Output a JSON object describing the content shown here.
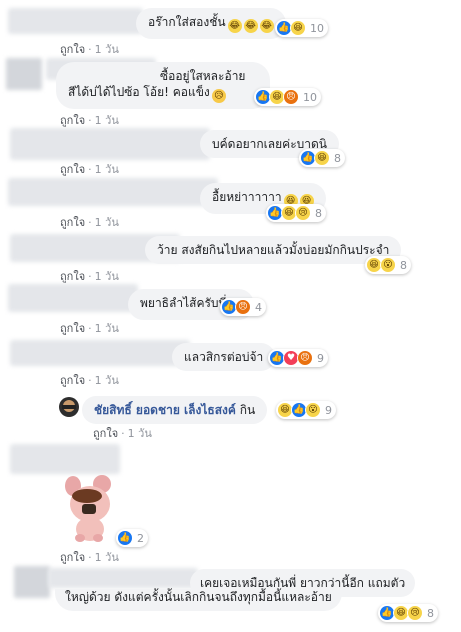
{
  "like_label": "ถูกใจ",
  "dot": "·",
  "time_label": "1 วัน",
  "comments": [
    {
      "text": "อร๊ากใส่สองชั้น",
      "reaction_count": "10"
    },
    {
      "line1": "ซื้ออยู่ใสหละอ้าย",
      "line2": "สีได้บ่ได้ไปซ้อ โอ้ย! คอแข็ง",
      "reaction_count": "10"
    },
    {
      "text": "บค์ดอยากเลยค่ะบาดนิ",
      "reaction_count": "8"
    },
    {
      "text": "อื้ยหย่าาาาาา",
      "reaction_count": "8"
    },
    {
      "text": "ว้าย สงสัยกินไปหลายแล้วมั้งบ่อยมักกินประจำ",
      "reaction_count": "8"
    },
    {
      "text": "พยาธิลำไส้ครับพี่",
      "reaction_count": "4"
    },
    {
      "text": "แลวสิกรต่อบ่จ้า",
      "reaction_count": "9"
    },
    {
      "author": "ชัยสิทธิ์ ยอดชาย เล็งไธสงค์",
      "text": "กิน",
      "reaction_count": "9"
    },
    {
      "reaction_count": "2"
    },
    {
      "line1": "เคยเจอเหมือนกันพี่ ยาวกว่านี้อีก แถมตัว",
      "line2": "ใหญ่ด้วย ดังแต่ครั้งนั้นเลิกกินจนถึงทุกมื้อนี้แหละอ้าย",
      "reaction_count": "8"
    }
  ],
  "icons": {
    "like": "like-icon",
    "haha": "haha-icon",
    "wow": "wow-icon",
    "sad": "sad-icon",
    "angry": "angry-icon",
    "love": "love-icon"
  },
  "colors": {
    "link": "#365899",
    "like_blue": "#1877f2",
    "bubble": "#f2f3f5",
    "meta": "#90949c"
  }
}
